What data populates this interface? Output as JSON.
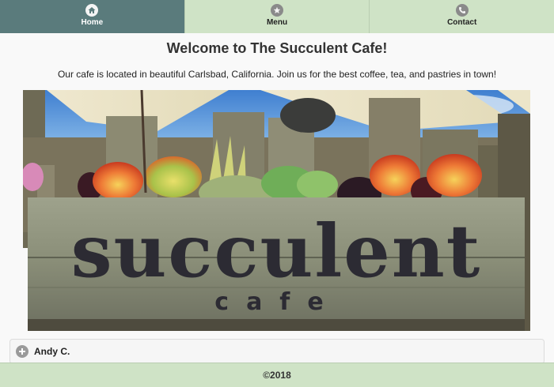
{
  "nav": {
    "tabs": [
      {
        "label": "Home",
        "icon": "home-icon",
        "active": true
      },
      {
        "label": "Menu",
        "icon": "star-icon",
        "active": false
      },
      {
        "label": "Contact",
        "icon": "phone-icon",
        "active": false
      }
    ]
  },
  "main": {
    "title": "Welcome to The Succulent Cafe!",
    "intro": "Our cafe is located in beautiful Carlsbad, California. Join us for the best coffee, tea, and pastries in town!",
    "hero": {
      "sign_word": "succulent",
      "sign_sub": "cafe"
    }
  },
  "testimonial": {
    "name": "Andy C.",
    "icon": "plus-circle-icon"
  },
  "footer": {
    "text": "©2018"
  },
  "colors": {
    "nav_active": "#5a7b7c",
    "nav_inactive": "#cfe3c6",
    "footer": "#cfe3c6"
  }
}
